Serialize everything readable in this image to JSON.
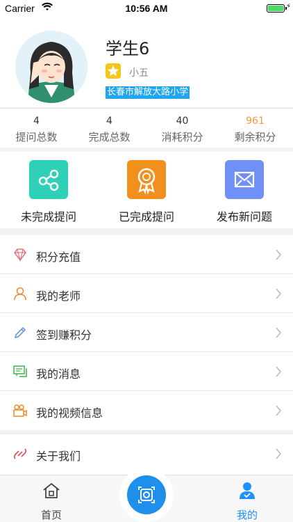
{
  "status_bar": {
    "carrier": "Carrier",
    "time": "10:56 AM"
  },
  "profile": {
    "name": "学生6",
    "grade": "小五",
    "school": "长春市解放大路小学"
  },
  "stats": [
    {
      "value": "4",
      "label": "提问总数"
    },
    {
      "value": "4",
      "label": "完成总数"
    },
    {
      "value": "40",
      "label": "消耗积分"
    },
    {
      "value": "961",
      "label": "剩余积分"
    }
  ],
  "quick_actions": [
    {
      "label": "未完成提问",
      "color": "#2ed1b8",
      "icon": "share-icon"
    },
    {
      "label": "已完成提问",
      "color": "#f2901e",
      "icon": "award-icon"
    },
    {
      "label": "发布新问题",
      "color": "#6f90f5",
      "icon": "mail-icon"
    }
  ],
  "menu": [
    {
      "label": "积分充值",
      "icon": "diamond-icon"
    },
    {
      "label": "我的老师",
      "icon": "person-icon"
    },
    {
      "label": "签到赚积分",
      "icon": "pencil-icon"
    },
    {
      "label": "我的消息",
      "icon": "message-icon"
    },
    {
      "label": "我的视频信息",
      "icon": "video-icon"
    }
  ],
  "menu2": [
    {
      "label": "关于我们",
      "icon": "link-icon"
    }
  ],
  "tabbar": {
    "home": "首页",
    "mine": "我的",
    "accent": "#1e90ff"
  }
}
